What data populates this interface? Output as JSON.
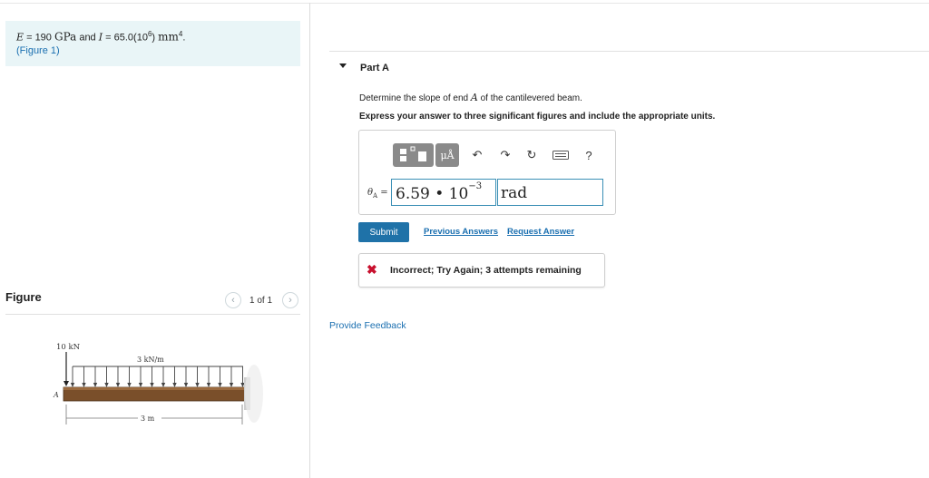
{
  "given": {
    "e_symbol": "E",
    "e_equals": " = 190 ",
    "e_unit": "GPa",
    "and": " and ",
    "i_symbol": "I",
    "i_equals": " = 65.0(10",
    "i_exp": "6",
    "i_close": ") ",
    "i_unit": "mm",
    "i_unit_exp": "4",
    "period": ".",
    "figure_link": "(Figure 1)"
  },
  "figure": {
    "title": "Figure",
    "pager": "1 of 1",
    "prev_icon": "chevron-left-icon",
    "next_icon": "chevron-right-icon",
    "labels": {
      "load": "10 kN",
      "distributed": "3 kN/m",
      "point_a": "A",
      "length": "3 m"
    }
  },
  "part": {
    "label": "Part A",
    "question_prefix": "Determine the slope of end ",
    "question_symbol": "A",
    "question_suffix": " of the cantilevered beam.",
    "instruction": "Express your answer to three significant figures and include the appropriate units."
  },
  "toolbar": {
    "units_label": "μÅ",
    "undo_icon": "undo-icon",
    "redo_icon": "redo-icon",
    "reset_icon": "reset-icon",
    "keyboard_icon": "keyboard-icon",
    "help": "?"
  },
  "answer": {
    "label": "θ",
    "label_sub": "A",
    "label_eq": " =",
    "value": "6.59 • 10",
    "exponent": "−3",
    "unit": "rad"
  },
  "actions": {
    "submit": "Submit",
    "previous_answers": "Previous Answers",
    "request_answer": "Request Answer"
  },
  "feedback": {
    "status_icon": "x-icon",
    "message": "Incorrect; Try Again; 3 attempts remaining"
  },
  "provide_feedback": "Provide Feedback",
  "colors": {
    "accent": "#1f72a8",
    "link": "#1a6fb0",
    "error": "#c8102e",
    "given_bg": "#e9f5f7"
  }
}
